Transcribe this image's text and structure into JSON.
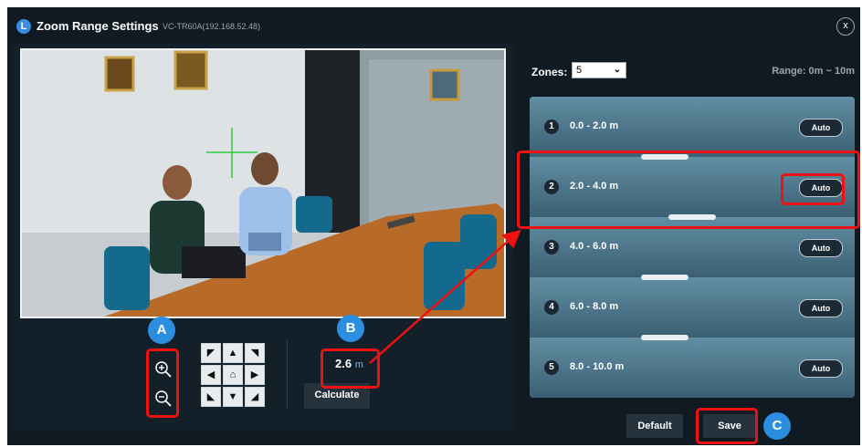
{
  "window": {
    "logo_letter": "L",
    "title": "Zoom Range Settings",
    "device": "VC-TR60A(192.168.52.48)",
    "close_label": "x"
  },
  "controls": {
    "zoom_in_icon": "zoom-in-icon",
    "zoom_out_icon": "zoom-out-icon",
    "ptz": [
      {
        "name": "pan-up-left",
        "glyph": "◤"
      },
      {
        "name": "pan-up",
        "glyph": "▲"
      },
      {
        "name": "pan-up-right",
        "glyph": "◥"
      },
      {
        "name": "pan-left",
        "glyph": "◀"
      },
      {
        "name": "home",
        "glyph": "⌂"
      },
      {
        "name": "pan-right",
        "glyph": "▶"
      },
      {
        "name": "pan-down-left",
        "glyph": "◣"
      },
      {
        "name": "pan-down",
        "glyph": "▼"
      },
      {
        "name": "pan-down-right",
        "glyph": "◢"
      }
    ],
    "distance_value": "2.6",
    "distance_unit": "m",
    "calculate_label": "Calculate"
  },
  "zones": {
    "label": "Zones:",
    "selected": "5",
    "range_label": "Range: 0m ~ 10m",
    "items": [
      {
        "number": "1",
        "range": "0.0 - 2.0 m",
        "mode": "Auto"
      },
      {
        "number": "2",
        "range": "2.0 - 4.0 m",
        "mode": "Auto"
      },
      {
        "number": "3",
        "range": "4.0 - 6.0 m",
        "mode": "Auto"
      },
      {
        "number": "4",
        "range": "6.0 - 8.0 m",
        "mode": "Auto"
      },
      {
        "number": "5",
        "range": "8.0 - 10.0 m",
        "mode": "Auto"
      }
    ]
  },
  "footer": {
    "default_label": "Default",
    "save_label": "Save"
  },
  "annotations": {
    "marker_a": "A",
    "marker_b": "B",
    "marker_c": "C",
    "highlight_color": "#ee1111",
    "marker_color": "#2c8ee0"
  }
}
